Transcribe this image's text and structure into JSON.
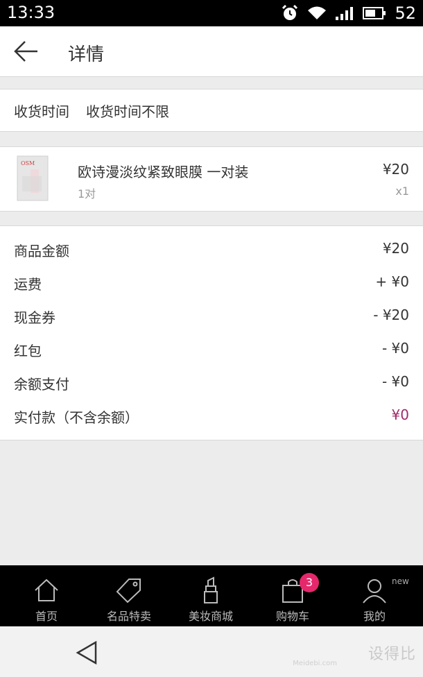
{
  "status_bar": {
    "time": "13:33",
    "battery": "52"
  },
  "header": {
    "title": "详情"
  },
  "delivery": {
    "label": "收货时间",
    "value": "收货时间不限"
  },
  "product": {
    "name": "欧诗漫淡纹紧致眼膜 一对装",
    "spec": "1对",
    "price": "¥20",
    "quantity": "x1",
    "thumb_brand": "OSM"
  },
  "summary": {
    "rows": [
      {
        "label": "商品金额",
        "value": "¥20"
      },
      {
        "label": "运费",
        "value": "+ ¥0"
      },
      {
        "label": "现金券",
        "value": "- ¥20"
      },
      {
        "label": "红包",
        "value": "- ¥0"
      },
      {
        "label": "余额支付",
        "value": "- ¥0"
      },
      {
        "label": "实付款（不含余额）",
        "value": "¥0"
      }
    ],
    "accent_color": "#a02a6a"
  },
  "bottom_nav": {
    "items": [
      {
        "label": "首页",
        "icon": "home-icon"
      },
      {
        "label": "名品特卖",
        "icon": "tag-icon"
      },
      {
        "label": "美妆商城",
        "icon": "lipstick-icon"
      },
      {
        "label": "购物车",
        "icon": "shopping-bag-icon",
        "badge": "3"
      },
      {
        "label": "我的",
        "icon": "user-icon",
        "new_tag": "new"
      }
    ],
    "badge_color": "#e5286b"
  },
  "watermark": {
    "text": "设得比",
    "sub": "Meidebi.com"
  }
}
